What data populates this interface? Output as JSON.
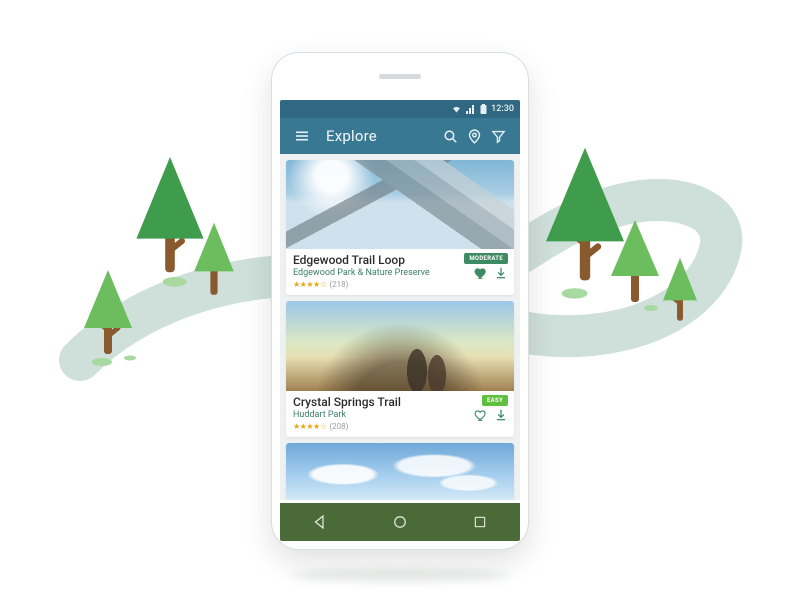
{
  "statusbar": {
    "time": "12:30"
  },
  "appbar": {
    "title": "Explore"
  },
  "difficulty_colors": {
    "MODERATE": "#3e8a63",
    "EASY": "#5fbf3f"
  },
  "colors": {
    "heart_filled": "#3e8a63",
    "heart_outline": "#3e8a63",
    "download": "#3e8a63"
  },
  "trails": [
    {
      "title": "Edgewood Trail Loop",
      "subtitle": "Edgewood Park & Nature Preserve",
      "rating_stars": "★★★★☆",
      "reviews_text": "(218)",
      "difficulty": "MODERATE",
      "favorited": true,
      "photo": "mountain"
    },
    {
      "title": "Crystal Springs Trail",
      "subtitle": "Huddart Park",
      "rating_stars": "★★★★☆",
      "reviews_text": "(208)",
      "difficulty": "EASY",
      "favorited": false,
      "photo": "hikers"
    },
    {
      "title": "",
      "subtitle": "",
      "rating_stars": "",
      "reviews_text": "",
      "difficulty": "",
      "favorited": false,
      "photo": "sky",
      "peek": true
    }
  ]
}
